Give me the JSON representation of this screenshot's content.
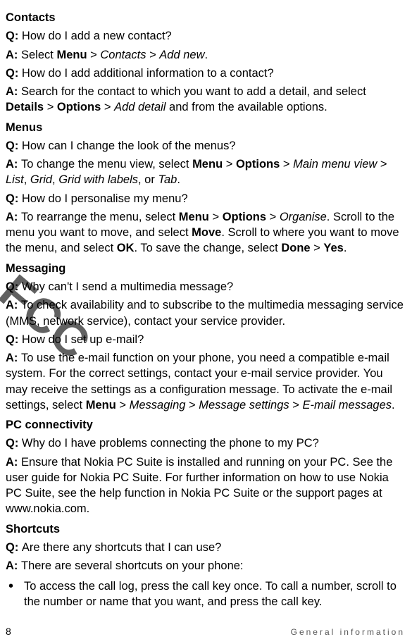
{
  "watermark": "FCC",
  "footer": {
    "page": "8",
    "section": "General information"
  },
  "sections": {
    "contacts": {
      "heading": "Contacts",
      "q1": {
        "label": "Q: ",
        "text": "How do I add a new contact?"
      },
      "a1": {
        "label": "A: ",
        "p1": "Select ",
        "menu": "Menu",
        "gt1": " > ",
        "contacts": "Contacts",
        "gt2": " > ",
        "addnew": "Add new",
        "end": "."
      },
      "q2": {
        "label": "Q: ",
        "text": "How do I add additional information to a contact?"
      },
      "a2": {
        "label": "A: ",
        "p1": "Search for the contact to which you want to add a detail, and select ",
        "details": "Details",
        "gt1": " > ",
        "options": "Options",
        "gt2": " > ",
        "adddetail": "Add detail",
        "end": " and from the available options."
      }
    },
    "menus": {
      "heading": "Menus",
      "q1": {
        "label": "Q: ",
        "text": "How can I change the look of the menus?"
      },
      "a1": {
        "label": "A: ",
        "p1": "To change the menu view, select ",
        "menu": "Menu",
        "gt1": " > ",
        "options": "Options",
        "gt2": " > ",
        "mmv": "Main menu view",
        "gt3": " > ",
        "list": "List",
        "c1": ", ",
        "grid": "Grid",
        "c2": ", ",
        "gwl": "Grid with labels",
        "c3": ", or ",
        "tab": "Tab",
        "end": "."
      },
      "q2": {
        "label": "Q: ",
        "text": "How do I personalise my menu?"
      },
      "a2": {
        "label": "A: ",
        "p1": "To rearrange the menu, select ",
        "menu": "Menu",
        "gt1": " > ",
        "options": "Options",
        "gt2": " > ",
        "organise": "Organise",
        "p2": ". Scroll to the menu you want to move, and select ",
        "move": "Move",
        "p3": ". Scroll to where you want to move the menu, and select ",
        "ok": "OK",
        "p4": ". To save the change, select ",
        "done": "Done",
        "gt3": " > ",
        "yes": "Yes",
        "end": "."
      }
    },
    "messaging": {
      "heading": "Messaging",
      "q1": {
        "label": "Q: ",
        "text": "Why can't I send a multimedia message?"
      },
      "a1": {
        "label": "A: ",
        "text": "To check availability and to subscribe to the multimedia messaging service (MMS, network service), contact your service provider."
      },
      "q2": {
        "label": "Q: ",
        "text": "How do I set up e-mail?"
      },
      "a2": {
        "label": "A: ",
        "p1": "To use the e-mail function on your phone, you need a compatible e-mail system. For the correct settings, contact your e-mail service provider. You may receive the settings as a configuration message. To activate the e-mail settings, select ",
        "menu": "Menu",
        "gt1": " > ",
        "msging": "Messaging",
        "gt2": " > ",
        "msettings": "Message settings",
        "gt3": " > ",
        "email": "E-mail messages",
        "end": "."
      }
    },
    "pc": {
      "heading": "PC connectivity",
      "q1": {
        "label": "Q: ",
        "text": "Why do I have problems connecting the phone to my PC?"
      },
      "a1": {
        "label": "A: ",
        "text": "Ensure that Nokia PC Suite is installed and running on your PC. See the user guide for Nokia PC Suite. For further information on how to use Nokia PC Suite, see the help function in Nokia PC Suite or the support pages at www.nokia.com."
      }
    },
    "shortcuts": {
      "heading": "Shortcuts",
      "q1": {
        "label": "Q: ",
        "text": "Are there any shortcuts that I can use?"
      },
      "a1": {
        "label": "A: ",
        "text": "There are several shortcuts on your phone:"
      },
      "b1": "To access the call log, press the call key once. To call a number, scroll to the number or name that you want, and press the call key."
    }
  }
}
